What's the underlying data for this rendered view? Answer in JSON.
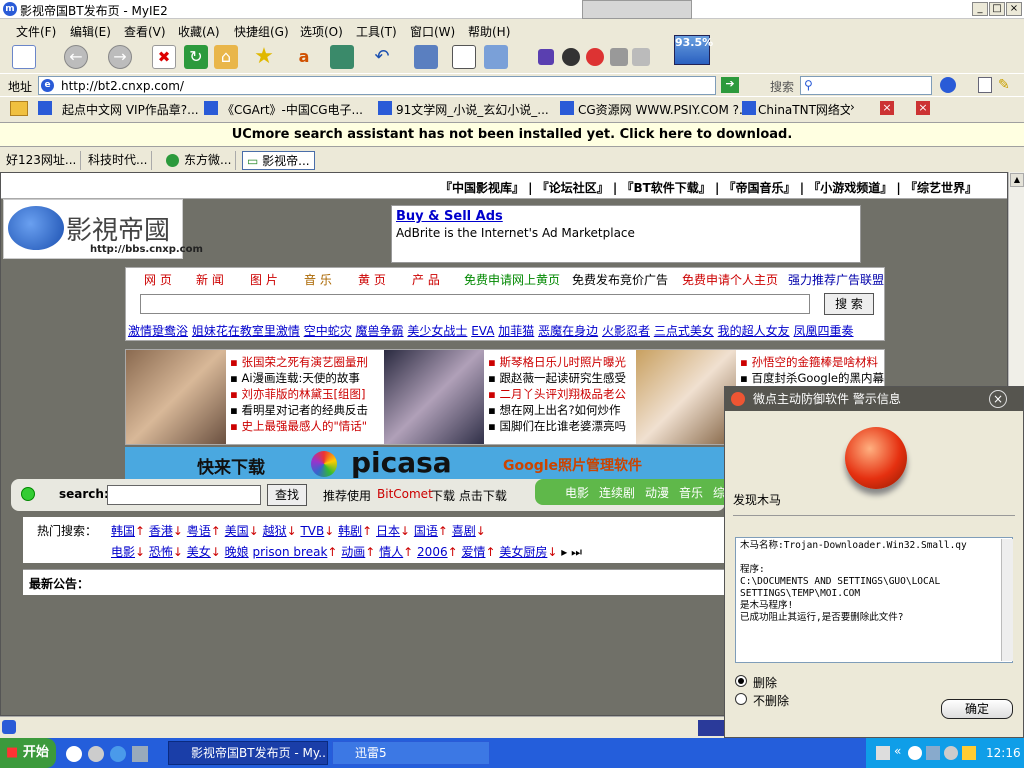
{
  "window": {
    "title": "影视帝国BT发布页 - MyIE2",
    "min": "_",
    "max": "□",
    "close": "×"
  },
  "menu": [
    "文件(F)",
    "编辑(E)",
    "查看(V)",
    "收藏(A)",
    "快捷组(G)",
    "选项(O)",
    "工具(T)",
    "窗口(W)",
    "帮助(H)"
  ],
  "toolbar": {
    "progress": "93.5%"
  },
  "address": {
    "label": "地址",
    "url": "http://bt2.cnxp.com/",
    "search_label": "搜索",
    "search_value": ""
  },
  "favorites": [
    "起点中文网 VIP作品章?...",
    "《CGArt》-中国CG电子...",
    "91文学网_小说_玄幻小说_...",
    "CG资源网 WWW.PSIY.COM ?...",
    "ChinaTNT网络文5"
  ],
  "ucmore": "UCmore search assistant has not been installed yet. Click here to download.",
  "tabs": [
    "好123网址...",
    "科技时代...",
    "东方微...",
    "影视帝..."
  ],
  "page": {
    "topnav": "『中国影视库』 | 『论坛社区』 | 『BT软件下载』 | 『帝国音乐』 | 『小游戏频道』 | 『综艺世界』",
    "logo_url": "http://bbs.cnxp.com",
    "logo_text": "影視帝國",
    "ad_title": "Buy & Sell Ads",
    "ad_text": "AdBrite is the Internet's Ad Marketplace",
    "channels": [
      "网 页",
      "新 闻",
      "图 片",
      "音 乐",
      "黄 页",
      "产 品"
    ],
    "promo": [
      "免费申请网上黄页",
      "免费发布竞价广告",
      "免费申请个人主页",
      "强力推荐广告联盟"
    ],
    "search_button": "搜 索",
    "hot_links": [
      "激情跫鸯浴",
      "姐妹花在教室里激情",
      "空中蛇灾",
      "魔兽争霸",
      "美少女战士",
      "EVA",
      "加菲猫",
      "恶魔在身边",
      "火影忍者",
      "三点式美女",
      "我的超人女友",
      "凤凰四重奏"
    ],
    "news1": [
      "张国荣之死有演艺圈量刑",
      "Ai漫画连载:天使的故事",
      "刘亦菲版的林黛玉[组图]",
      "看明星对记者的经典反击",
      "史上最强最感人的\"情话\""
    ],
    "news2": [
      "斯琴格日乐儿时照片曝光",
      "跟赵薇一起读研究生感受",
      "二月丫头评刘翔极品老公",
      "想在网上出名?如何炒作",
      "国脚们在比谁老婆漂亮吗"
    ],
    "news3": [
      "孙悟空的金箍棒是啥材料",
      "百度封杀Google的黑内幕"
    ],
    "banner_left": "快来下载",
    "banner_picasa": "picasa",
    "banner_right": "Google照片管理软件",
    "search_label": "search:",
    "search_btn": "查找",
    "bitcomet_pre": "推荐使用",
    "bitcomet": "BitComet",
    "bitcomet_post": "下载 点击下载",
    "cats": [
      "电影",
      "连续剧",
      "动漫",
      "音乐",
      "综"
    ],
    "hot_label": "热门搜索：",
    "hot_row1": [
      "韩国",
      "香港",
      "粤语",
      "美国",
      "越狱",
      "TVB",
      "韩剧",
      "日本",
      "国语",
      "喜剧"
    ],
    "hot_row2": [
      "电影",
      "恐怖",
      "美女",
      "晚娘",
      "prison break",
      "动画",
      "情人",
      "2006",
      "爱情",
      "美女厨房"
    ],
    "notice_label": "最新公告："
  },
  "alert": {
    "title": "微点主动防御软件  警示信息",
    "found": "发现木马",
    "detail": "木马名称:Trojan-Downloader.Win32.Small.qy\n\n程序:\nC:\\DOCUMENTS AND SETTINGS\\GUO\\LOCAL SETTINGS\\TEMP\\MOI.COM\n是木马程序!\n已成功阻止其运行,是否要删除此文件?",
    "opt_delete": "删除",
    "opt_keep": "不删除",
    "ok": "确定"
  },
  "taskbar": {
    "start": "开始",
    "task1": "影视帝国BT发布页 - My...",
    "task2": "迅雷5",
    "clock": "12:16"
  }
}
